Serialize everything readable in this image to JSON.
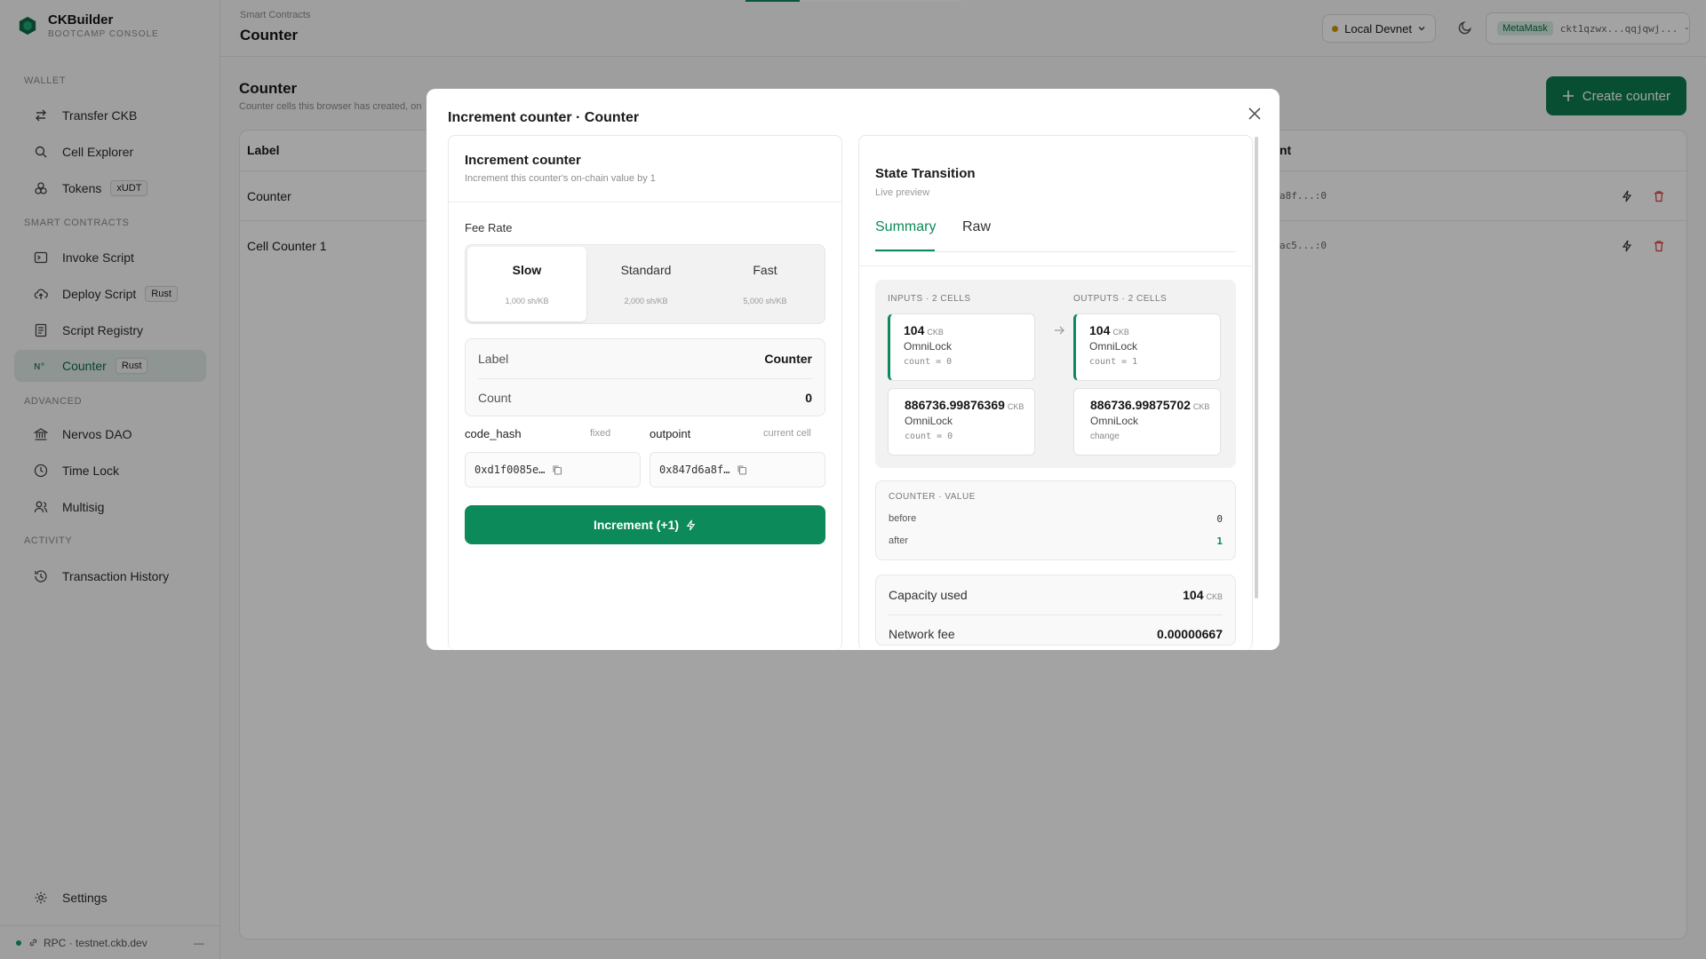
{
  "brand": {
    "name": "CKBuilder",
    "subtitle": "BOOTCAMP CONSOLE"
  },
  "sidebar": {
    "sections": [
      {
        "label": "WALLET"
      },
      {
        "label": "SMART CONTRACTS"
      },
      {
        "label": "ADVANCED"
      },
      {
        "label": "ACTIVITY"
      }
    ],
    "items": [
      {
        "label": "Transfer CKB",
        "icon": "transfer-icon"
      },
      {
        "label": "Cell Explorer",
        "icon": "search-icon"
      },
      {
        "label": "Tokens",
        "icon": "tokens-icon",
        "badge": "xUDT"
      },
      {
        "label": "Invoke Script",
        "icon": "terminal-icon"
      },
      {
        "label": "Deploy Script",
        "icon": "cloud-upload-icon",
        "badge": "Rust"
      },
      {
        "label": "Script Registry",
        "icon": "registry-icon"
      },
      {
        "label": "Counter",
        "icon": "number-icon",
        "badge": "Rust",
        "active": true
      },
      {
        "label": "Nervos DAO",
        "icon": "bank-icon"
      },
      {
        "label": "Time Lock",
        "icon": "clock-icon"
      },
      {
        "label": "Multisig",
        "icon": "users-icon"
      },
      {
        "label": "Transaction History",
        "icon": "history-icon"
      }
    ],
    "settings_label": "Settings",
    "footer": {
      "rpc_label": "RPC · testnet.ckb.dev",
      "collapse": "—"
    }
  },
  "header": {
    "breadcrumb": "Smart Contracts",
    "title": "Counter",
    "progress": 0.25,
    "network": "Local Devnet",
    "wallet_tag": "MetaMask",
    "wallet_address": "ckt1qzwx...qqjqwj..."
  },
  "main": {
    "title": "Counter",
    "subtitle": "Counter cells this browser has created, on",
    "create_label": "Create counter",
    "columns": {
      "label": "Label",
      "outpoint_suffix": "nt"
    },
    "rows": [
      {
        "label": "Counter",
        "outpoint": "a8f...:0"
      },
      {
        "label": "Cell Counter 1",
        "outpoint": "ac5...:0"
      }
    ]
  },
  "modal": {
    "title": "Increment counter · Counter",
    "left": {
      "title": "Increment counter",
      "subtitle": "Increment this counter's on-chain value by 1",
      "fee_label": "Fee Rate",
      "fee_options": [
        {
          "name": "Slow",
          "rate": "1,000 sh/KB",
          "selected": true
        },
        {
          "name": "Standard",
          "rate": "2,000 sh/KB"
        },
        {
          "name": "Fast",
          "rate": "5,000 sh/KB"
        }
      ],
      "info": [
        {
          "key": "Label",
          "value": "Counter"
        },
        {
          "key": "Count",
          "value": "0"
        }
      ],
      "code_hash": {
        "label": "code_hash",
        "hint": "fixed",
        "value": "0xd1f0085e…"
      },
      "outpoint": {
        "label": "outpoint",
        "hint": "current cell",
        "value": "0x847d6a8f…"
      },
      "action_label": "Increment (+1)"
    },
    "right": {
      "title": "State Transition",
      "subtitle": "Live preview",
      "tabs": [
        "Summary",
        "Raw"
      ],
      "inputs_head": "INPUTS · 2 CELLS",
      "outputs_head": "OUTPUTS · 2 CELLS",
      "inputs": [
        {
          "amount": "104",
          "unit": "CKB",
          "lock": "OmniLock",
          "meta": "count = 0"
        },
        {
          "amount": "886736.99876369",
          "unit": "CKB",
          "lock": "OmniLock",
          "meta": "count = 0"
        }
      ],
      "outputs": [
        {
          "amount": "104",
          "unit": "CKB",
          "lock": "OmniLock",
          "meta": "count = 1"
        },
        {
          "amount": "886736.99875702",
          "unit": "CKB",
          "lock": "OmniLock",
          "meta": "change"
        }
      ],
      "counter_head": "COUNTER · VALUE",
      "before_label": "before",
      "before_value": "0",
      "after_label": "after",
      "after_value": "1",
      "capacity_label": "Capacity used",
      "capacity_value": "104",
      "capacity_unit": "CKB",
      "fee_label_partial": "Network fee",
      "fee_value_partial": "0.00000667"
    }
  },
  "colors": {
    "accent": "#0d8a5a",
    "sidebar_active": "#dfe9e4",
    "danger": "#d93a3a"
  }
}
